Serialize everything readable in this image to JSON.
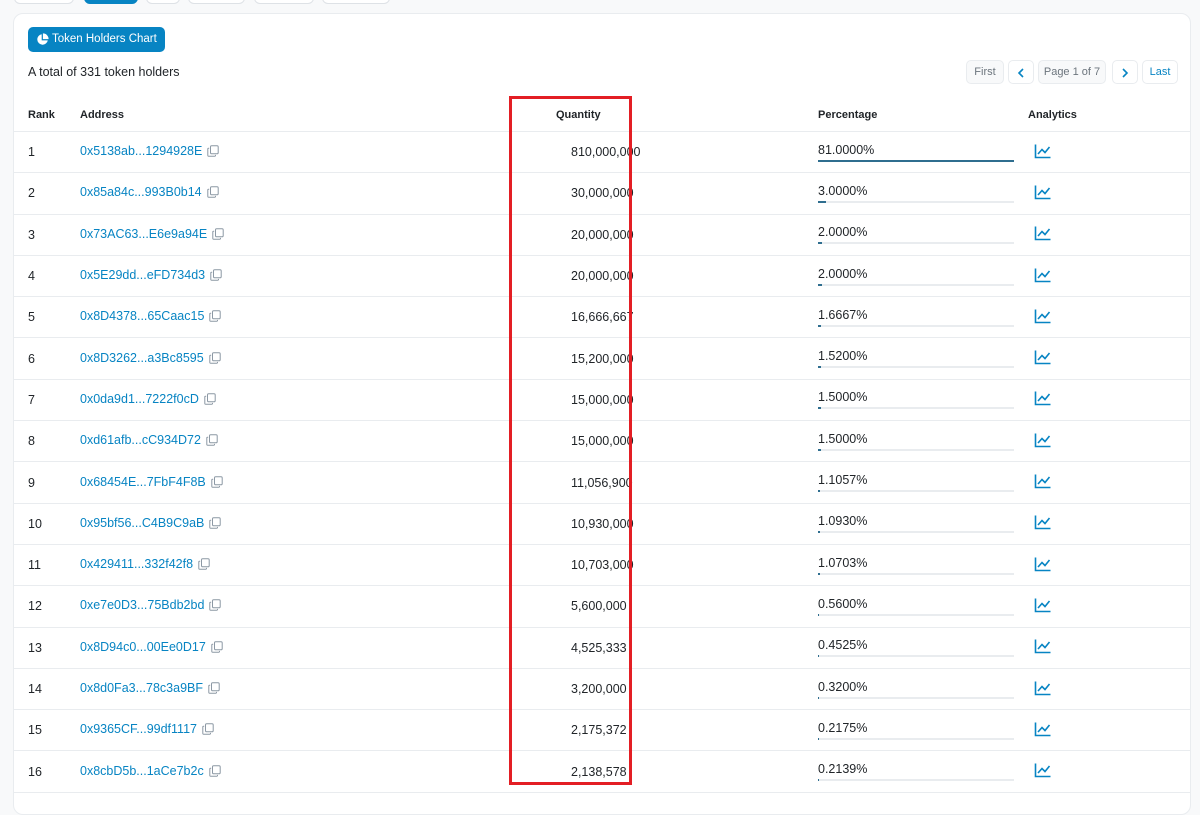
{
  "page": {
    "chart_button_label": "Token Holders Chart",
    "total_text": "A total of 331 token holders"
  },
  "pagination": {
    "first": "First",
    "page_text": "Page 1 of 7",
    "last": "Last"
  },
  "table": {
    "headers": {
      "rank": "Rank",
      "address": "Address",
      "quantity": "Quantity",
      "percentage": "Percentage",
      "analytics": "Analytics"
    },
    "rows": [
      {
        "rank": "1",
        "address": "0x5138ab...1294928E",
        "quantity": "810,000,000",
        "percentage": "81.0000%",
        "pct_value": 81.0
      },
      {
        "rank": "2",
        "address": "0x85a84c...993B0b14",
        "quantity": "30,000,000",
        "percentage": "3.0000%",
        "pct_value": 3.0
      },
      {
        "rank": "3",
        "address": "0x73AC63...E6e9a94E",
        "quantity": "20,000,000",
        "percentage": "2.0000%",
        "pct_value": 2.0
      },
      {
        "rank": "4",
        "address": "0x5E29dd...eFD734d3",
        "quantity": "20,000,000",
        "percentage": "2.0000%",
        "pct_value": 2.0
      },
      {
        "rank": "5",
        "address": "0x8D4378...65Caac15",
        "quantity": "16,666,667",
        "percentage": "1.6667%",
        "pct_value": 1.6667
      },
      {
        "rank": "6",
        "address": "0x8D3262...a3Bc8595",
        "quantity": "15,200,000",
        "percentage": "1.5200%",
        "pct_value": 1.52
      },
      {
        "rank": "7",
        "address": "0x0da9d1...7222f0cD",
        "quantity": "15,000,000",
        "percentage": "1.5000%",
        "pct_value": 1.5
      },
      {
        "rank": "8",
        "address": "0xd61afb...cC934D72",
        "quantity": "15,000,000",
        "percentage": "1.5000%",
        "pct_value": 1.5
      },
      {
        "rank": "9",
        "address": "0x68454E...7FbF4F8B",
        "quantity": "11,056,900",
        "percentage": "1.1057%",
        "pct_value": 1.1057
      },
      {
        "rank": "10",
        "address": "0x95bf56...C4B9C9aB",
        "quantity": "10,930,000",
        "percentage": "1.0930%",
        "pct_value": 1.093
      },
      {
        "rank": "11",
        "address": "0x429411...332f42f8",
        "quantity": "10,703,000",
        "percentage": "1.0703%",
        "pct_value": 1.0703
      },
      {
        "rank": "12",
        "address": "0xe7e0D3...75Bdb2bd",
        "quantity": "5,600,000",
        "percentage": "0.5600%",
        "pct_value": 0.56
      },
      {
        "rank": "13",
        "address": "0x8D94c0...00Ee0D17",
        "quantity": "4,525,333",
        "percentage": "0.4525%",
        "pct_value": 0.4525
      },
      {
        "rank": "14",
        "address": "0x8d0Fa3...78c3a9BF",
        "quantity": "3,200,000",
        "percentage": "0.3200%",
        "pct_value": 0.32
      },
      {
        "rank": "15",
        "address": "0x9365CF...99df1117",
        "quantity": "2,175,372",
        "percentage": "0.2175%",
        "pct_value": 0.2175
      },
      {
        "rank": "16",
        "address": "0x8cbD5b...1aCe7b2c",
        "quantity": "2,138,578",
        "percentage": "0.2139%",
        "pct_value": 0.2139
      }
    ]
  },
  "icons": {
    "chart_button": "pie-chart-icon",
    "copy": "copy-icon",
    "analytics": "line-chart-icon",
    "prev": "chevron-left-icon",
    "next": "chevron-right-icon"
  },
  "colors": {
    "accent": "#0784c3",
    "link": "#0784c3",
    "bar_fill": "#2f6e8f",
    "highlight": "#e31e24"
  }
}
